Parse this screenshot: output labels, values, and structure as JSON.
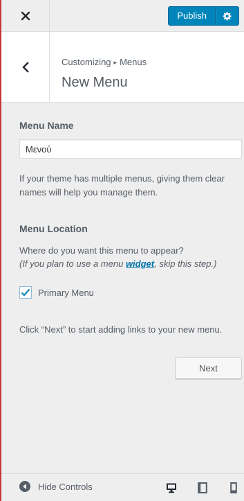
{
  "header": {
    "publish_label": "Publish"
  },
  "section": {
    "breadcrumb_prefix": "Customizing",
    "breadcrumb_separator": "▸",
    "breadcrumb_current": "Menus",
    "title": "New Menu"
  },
  "menu_name": {
    "label": "Menu Name",
    "value": "Μενού",
    "description": "If your theme has multiple menus, giving them clear names will help you manage them."
  },
  "menu_location": {
    "label": "Menu Location",
    "question": "Where do you want this menu to appear?",
    "hint_prefix": "(If you plan to use a menu ",
    "hint_link": "widget",
    "hint_suffix": ", skip this step.)",
    "options": [
      {
        "label": "Primary Menu",
        "checked": true
      }
    ]
  },
  "next_hint": "Click “Next” to start adding links to your new menu.",
  "next_label": "Next",
  "footer": {
    "hide_controls_label": "Hide Controls",
    "devices": [
      "desktop-icon",
      "tablet-icon",
      "mobile-icon"
    ]
  },
  "colors": {
    "accent": "#0085ba",
    "link": "#0073aa",
    "panel_background": "#eeeeee",
    "edge": "#c9343a"
  }
}
